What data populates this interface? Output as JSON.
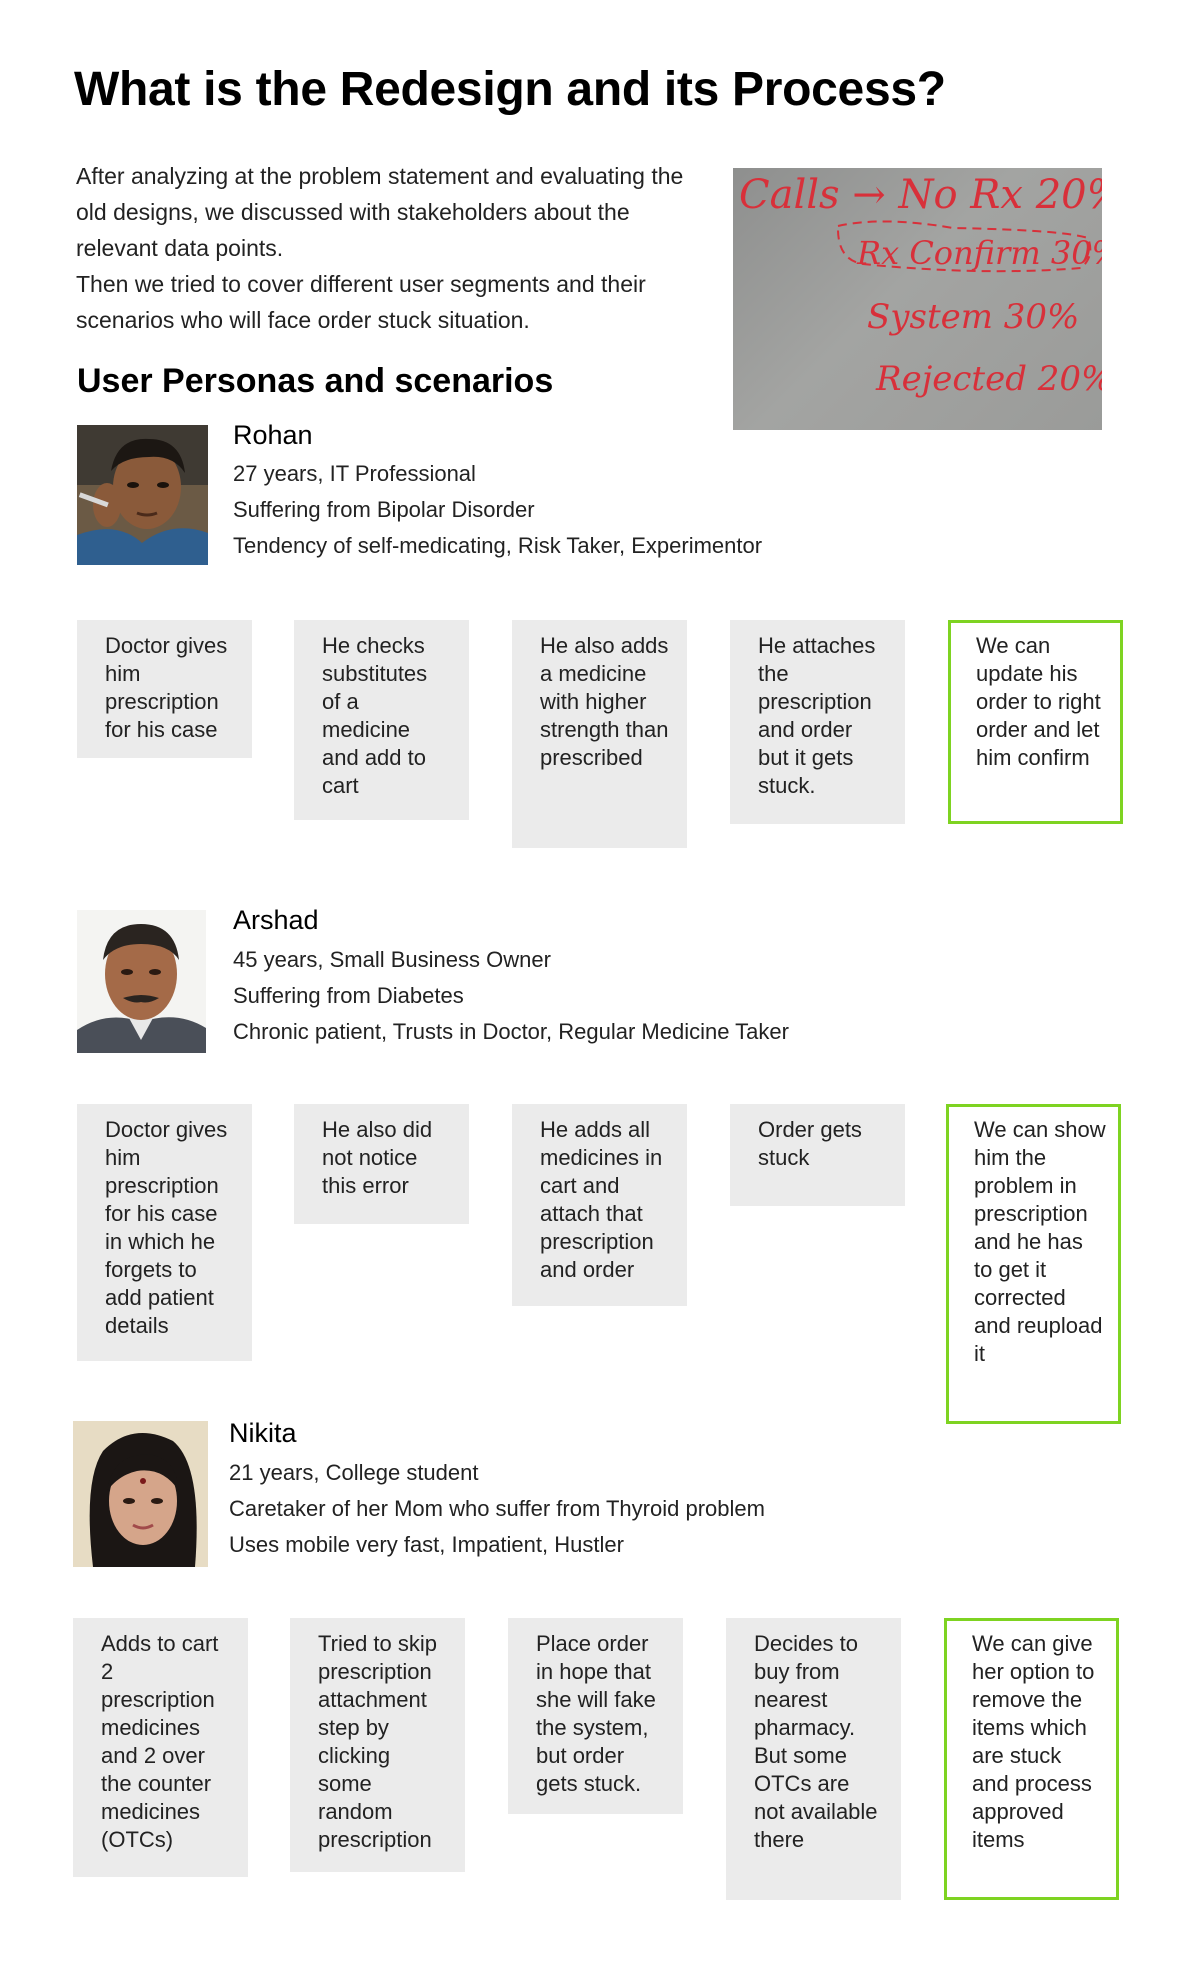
{
  "page": {
    "title": "What is the Redesign and its Process?",
    "intro": [
      "After analyzing at the problem statement and evaluating the old designs, we discussed with stakeholders about the relevant data points.",
      "Then we tried to cover different user segments and their scenarios who will face order stuck situation."
    ],
    "whiteboard_lines": [
      "Calls → No Rx 20%",
      "Rx Confirm 30%",
      "System 30%",
      "Rejected 20%"
    ],
    "section_title": "User Personas and scenarios"
  },
  "colors": {
    "solution_border": "#7ed321",
    "card_background": "#ebebeb",
    "whiteboard_ink": "#d8303a"
  },
  "personas": [
    {
      "name": "Rohan",
      "lines": [
        "27 years, IT Professional",
        "Suffering from Bipolar Disorder",
        "Tendency of self-medicating, Risk Taker, Experimentor"
      ],
      "scenarios": [
        "Doctor gives him prescription for his case",
        "He checks substitutes of a medicine and add to cart",
        "He also adds a medicine with higher strength than prescribed",
        "He attaches the prescription and order but it gets stuck.",
        "We can update his order to right order and let him confirm"
      ]
    },
    {
      "name": "Arshad",
      "lines": [
        "45 years, Small Business Owner",
        "Suffering from Diabetes",
        "Chronic patient, Trusts in Doctor, Regular Medicine Taker"
      ],
      "scenarios": [
        "Doctor gives him prescription for his case in which he forgets to add patient details",
        "He also did not notice this error",
        "He adds all medicines in cart and attach that prescription and order",
        "Order gets stuck",
        "We can show him the problem in prescription and he has to get it corrected and reupload it"
      ]
    },
    {
      "name": "Nikita",
      "lines": [
        "21 years, College student",
        "Caretaker of her Mom who suffer from Thyroid problem",
        "Uses mobile very fast, Impatient, Hustler"
      ],
      "scenarios": [
        "Adds to cart 2 prescription medicines and 2 over the counter medicines (OTCs)",
        "Tried to skip prescription attachment step by clicking some random prescription",
        "Place order in hope that she will fake the system, but order gets stuck.",
        "Decides to buy from nearest pharmacy. But some OTCs are not available there",
        "We can give her option to remove the items which are stuck and process approved items"
      ]
    }
  ]
}
